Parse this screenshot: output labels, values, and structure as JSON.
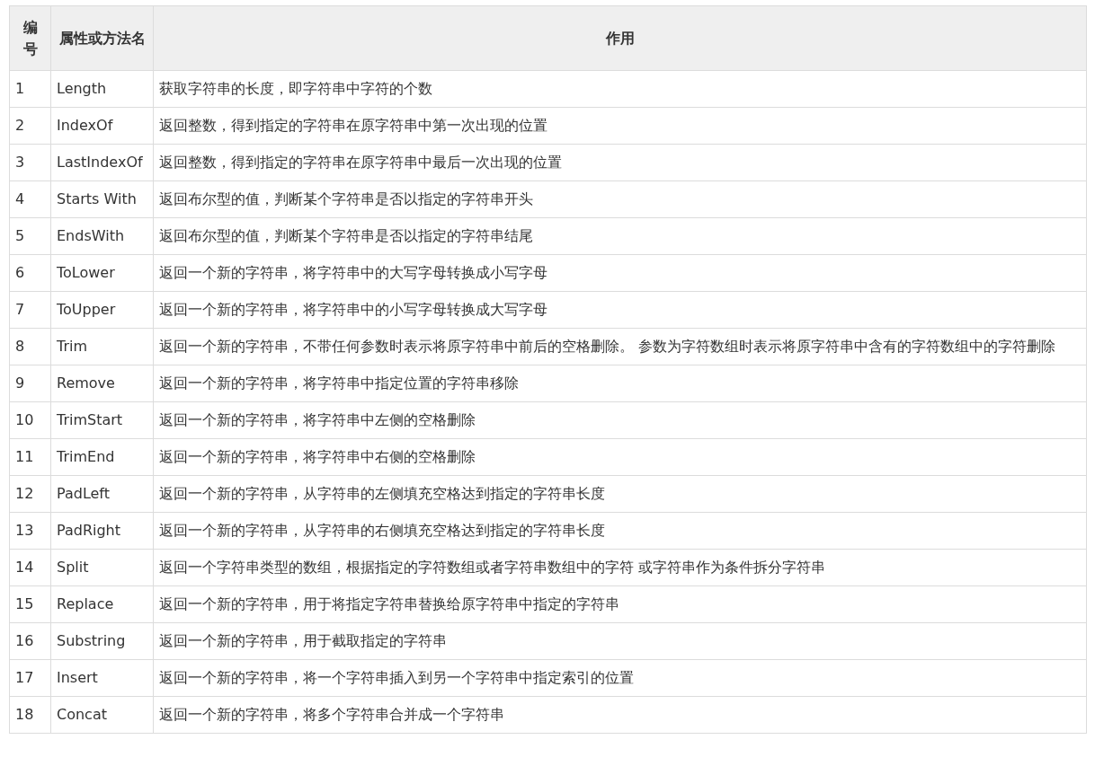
{
  "table": {
    "columns": [
      "编号",
      "属性或方法名",
      "作用"
    ],
    "rows": [
      [
        "1",
        "Length",
        "获取字符串的长度，即字符串中字符的个数"
      ],
      [
        "2",
        "IndexOf",
        "返回整数，得到指定的字符串在原字符串中第一次出现的位置"
      ],
      [
        "3",
        "LastIndexOf",
        "返回整数，得到指定的字符串在原字符串中最后一次出现的位置"
      ],
      [
        "4",
        "Starts With",
        "返回布尔型的值，判断某个字符串是否以指定的字符串开头"
      ],
      [
        "5",
        "EndsWith",
        "返回布尔型的值，判断某个字符串是否以指定的字符串结尾"
      ],
      [
        "6",
        "ToLower",
        "返回一个新的字符串，将字符串中的大写字母转换成小写字母"
      ],
      [
        "7",
        "ToUpper",
        "返回一个新的字符串，将字符串中的小写字母转换成大写字母"
      ],
      [
        "8",
        "Trim",
        "返回一个新的字符串，不带任何参数时表示将原字符串中前后的空格删除。 参数为字符数组时表示将原字符串中含有的字符数组中的字符删除"
      ],
      [
        "9",
        "Remove",
        "返回一个新的字符串，将字符串中指定位置的字符串移除"
      ],
      [
        "10",
        "TrimStart",
        "返回一个新的字符串，将字符串中左侧的空格删除"
      ],
      [
        "11",
        "TrimEnd",
        "返回一个新的字符串，将字符串中右侧的空格删除"
      ],
      [
        "12",
        "PadLeft",
        "返回一个新的字符串，从字符串的左侧填充空格达到指定的字符串长度"
      ],
      [
        "13",
        "PadRight",
        "返回一个新的字符串，从字符串的右侧填充空格达到指定的字符串长度"
      ],
      [
        "14",
        "Split",
        "返回一个字符串类型的数组，根据指定的字符数组或者字符串数组中的字符 或字符串作为条件拆分字符串"
      ],
      [
        "15",
        "Replace",
        "返回一个新的字符串，用于将指定字符串替换给原字符串中指定的字符串"
      ],
      [
        "16",
        "Substring",
        "返回一个新的字符串，用于截取指定的字符串"
      ],
      [
        "17",
        "Insert",
        "返回一个新的字符串，将一个字符串插入到另一个字符串中指定索引的位置"
      ],
      [
        "18",
        "Concat",
        "返回一个新的字符串，将多个字符串合并成一个字符串"
      ]
    ]
  }
}
